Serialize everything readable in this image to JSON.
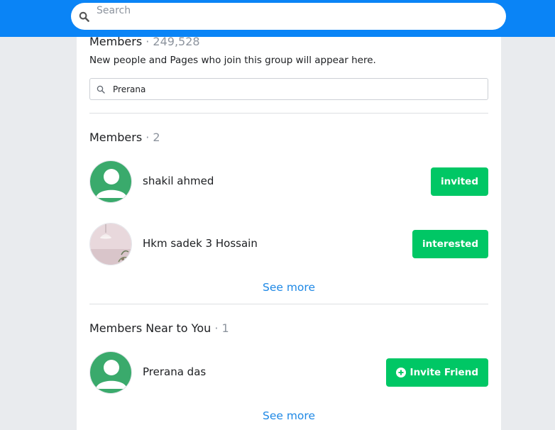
{
  "topbar": {
    "search_placeholder": "Search",
    "color": "#0a84f6"
  },
  "members_section": {
    "title": "Members",
    "count": "· 249,528",
    "description": "New people and Pages who join this group will appear here.",
    "search_value": "Prerana"
  },
  "results_section": {
    "title": "Members",
    "count": "· 2",
    "members": [
      {
        "name": "shakil ahmed",
        "action": "invited",
        "avatar_icon": "default-user-avatar-icon"
      },
      {
        "name": "Hkm sadek 3 Hossain",
        "action": "interested",
        "avatar_icon": "lamp-photo-avatar"
      }
    ],
    "see_more": "See more"
  },
  "near_section": {
    "title": "Members Near to You",
    "count": "· 1",
    "members": [
      {
        "name": "Prerana das",
        "action": "Invite Friend",
        "action_icon": "plus-circle-icon",
        "avatar_icon": "default-user-avatar-icon"
      }
    ],
    "see_more": "See more"
  },
  "colors": {
    "accent_green": "#00c765",
    "link_blue": "#1e88e5",
    "avatar_green": "#3aaa6c"
  }
}
